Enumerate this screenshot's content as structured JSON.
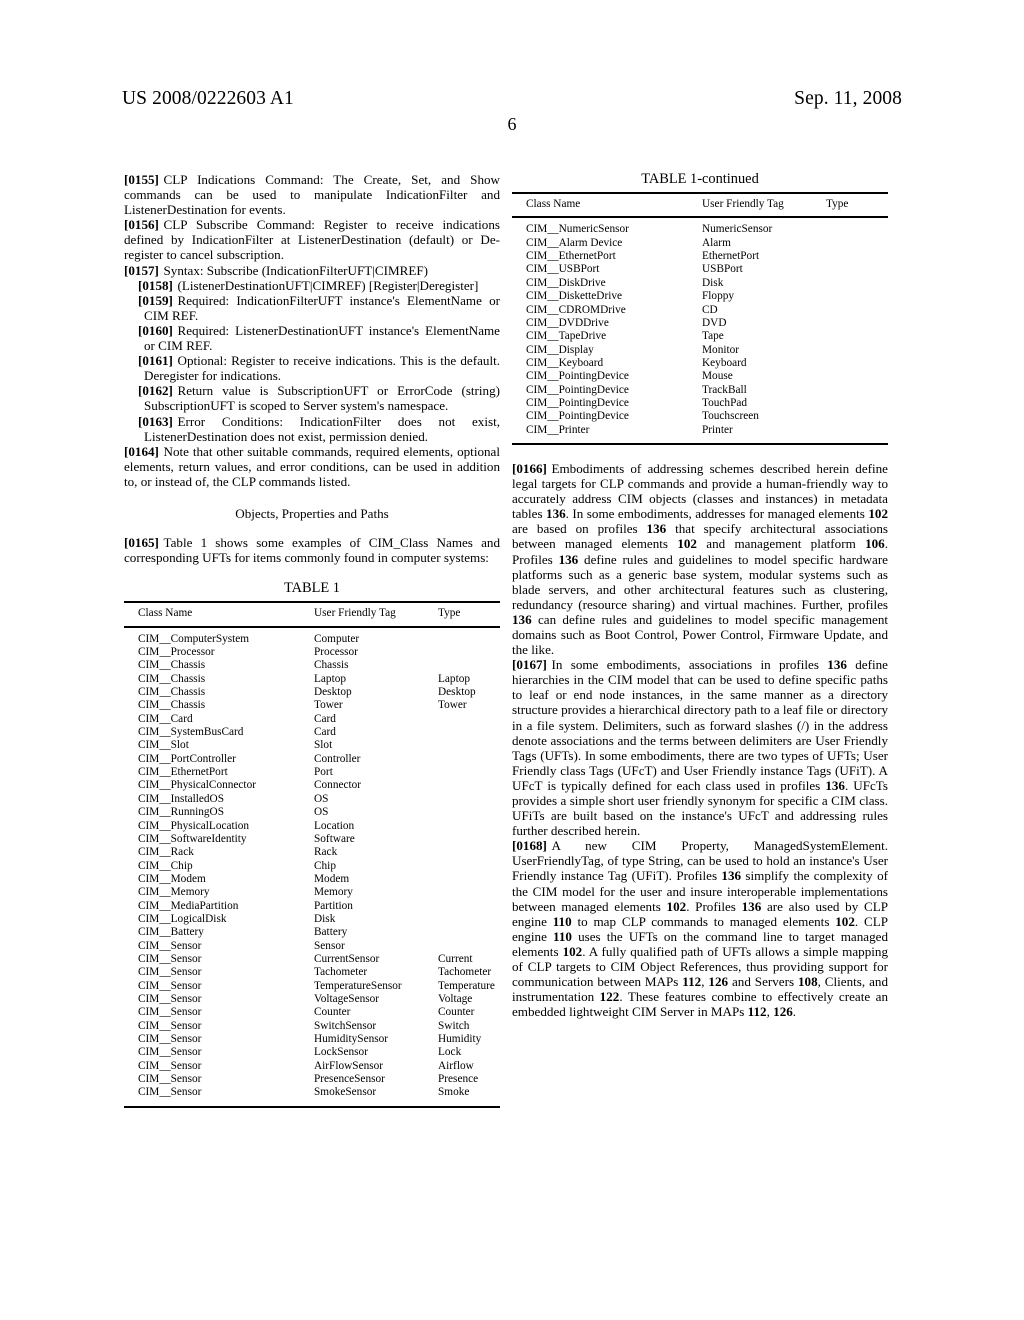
{
  "header": {
    "publication_number": "US 2008/0222603 A1",
    "publication_date": "Sep. 11, 2008",
    "page_number": "6"
  },
  "left_column": {
    "paragraphs": [
      {
        "id": "0155",
        "number": "[0155]",
        "text": "CLP Indications Command: The Create, Set, and Show commands can be used to manipulate IndicationFilter and ListenerDestination for events.",
        "style": "normal"
      },
      {
        "id": "0156",
        "number": "[0156]",
        "text": "CLP Subscribe Command: Register to receive indications defined by IndicationFilter at ListenerDestination (default) or De-register to cancel subscription.",
        "style": "normal"
      },
      {
        "id": "0157",
        "number": "[0157]",
        "text": "Syntax: Subscribe (IndicationFilterUFT|CIMREF)",
        "style": "normal"
      },
      {
        "id": "0158",
        "number": "[0158]",
        "text": "(ListenerDestinationUFT|CIMREF) [Register|Deregister]",
        "style": "sub"
      },
      {
        "id": "0159",
        "number": "[0159]",
        "text": "Required: IndicationFilterUFT instance's ElementName or CIM REF.",
        "style": "sub"
      },
      {
        "id": "0160",
        "number": "[0160]",
        "text": "Required: ListenerDestinationUFT instance's ElementName or CIM REF.",
        "style": "sub"
      },
      {
        "id": "0161",
        "number": "[0161]",
        "text": "Optional: Register to receive indications. This is the default. Deregister for indications.",
        "style": "sub"
      },
      {
        "id": "0162",
        "number": "[0162]",
        "text": "Return value is SubscriptionUFT or ErrorCode (string) SubscriptionUFT is scoped to Server system's namespace.",
        "style": "sub"
      },
      {
        "id": "0163",
        "number": "[0163]",
        "text": "Error Conditions: IndicationFilter does not exist, ListenerDestination does not exist, permission denied.",
        "style": "sub"
      },
      {
        "id": "0164",
        "number": "[0164]",
        "text": "Note that other suitable commands, required elements, optional elements, return values, and error conditions, can be used in addition to, or instead of, the CLP commands listed.",
        "style": "normal"
      }
    ],
    "section_heading": "Objects, Properties and Paths",
    "paragraph_0165": {
      "id": "0165",
      "number": "[0165]",
      "text": "Table 1 shows some examples of CIM_Class Names and corresponding UFTs for items commonly found in computer systems:"
    }
  },
  "table_1": {
    "title": "TABLE 1",
    "columns": [
      "Class Name",
      "User Friendly Tag",
      "Type"
    ],
    "rows": [
      [
        "CIM__ComputerSystem",
        "Computer",
        ""
      ],
      [
        "CIM__Processor",
        "Processor",
        ""
      ],
      [
        "CIM__Chassis",
        "Chassis",
        ""
      ],
      [
        "CIM__Chassis",
        "Laptop",
        "Laptop"
      ],
      [
        "CIM__Chassis",
        "Desktop",
        "Desktop"
      ],
      [
        "CIM__Chassis",
        "Tower",
        "Tower"
      ],
      [
        "CIM__Card",
        "Card",
        ""
      ],
      [
        "CIM__SystemBusCard",
        "Card",
        ""
      ],
      [
        "CIM__Slot",
        "Slot",
        ""
      ],
      [
        "CIM__PortController",
        "Controller",
        ""
      ],
      [
        "CIM__EthernetPort",
        "Port",
        ""
      ],
      [
        "CIM__PhysicalConnector",
        "Connector",
        ""
      ],
      [
        "CIM__InstalledOS",
        "OS",
        ""
      ],
      [
        "CIM__RunningOS",
        "OS",
        ""
      ],
      [
        "CIM__PhysicalLocation",
        "Location",
        ""
      ],
      [
        "CIM__SoftwareIdentity",
        "Software",
        ""
      ],
      [
        "CIM__Rack",
        "Rack",
        ""
      ],
      [
        "CIM__Chip",
        "Chip",
        ""
      ],
      [
        "CIM__Modem",
        "Modem",
        ""
      ],
      [
        "CIM__Memory",
        "Memory",
        ""
      ],
      [
        "CIM__MediaPartition",
        "Partition",
        ""
      ],
      [
        "CIM__LogicalDisk",
        "Disk",
        ""
      ],
      [
        "CIM__Battery",
        "Battery",
        ""
      ],
      [
        "CIM__Sensor",
        "Sensor",
        ""
      ],
      [
        "CIM__Sensor",
        "CurrentSensor",
        "Current"
      ],
      [
        "CIM__Sensor",
        "Tachometer",
        "Tachometer"
      ],
      [
        "CIM__Sensor",
        "TemperatureSensor",
        "Temperature"
      ],
      [
        "CIM__Sensor",
        "VoltageSensor",
        "Voltage"
      ],
      [
        "CIM__Sensor",
        "Counter",
        "Counter"
      ],
      [
        "CIM__Sensor",
        "SwitchSensor",
        "Switch"
      ],
      [
        "CIM__Sensor",
        "HumiditySensor",
        "Humidity"
      ],
      [
        "CIM__Sensor",
        "LockSensor",
        "Lock"
      ],
      [
        "CIM__Sensor",
        "AirFlowSensor",
        "Airflow"
      ],
      [
        "CIM__Sensor",
        "PresenceSensor",
        "Presence"
      ],
      [
        "CIM__Sensor",
        "SmokeSensor",
        "Smoke"
      ]
    ]
  },
  "table_1_continued": {
    "title": "TABLE 1-continued",
    "columns": [
      "Class Name",
      "User Friendly Tag",
      "Type"
    ],
    "rows": [
      [
        "CIM__NumericSensor",
        "NumericSensor",
        ""
      ],
      [
        "CIM__Alarm Device",
        "Alarm",
        ""
      ],
      [
        "CIM__EthernetPort",
        "EthernetPort",
        ""
      ],
      [
        "CIM__USBPort",
        "USBPort",
        ""
      ],
      [
        "CIM__DiskDrive",
        "Disk",
        ""
      ],
      [
        "CIM__DisketteDrive",
        "Floppy",
        ""
      ],
      [
        "CIM__CDROMDrive",
        "CD",
        ""
      ],
      [
        "CIM__DVDDrive",
        "DVD",
        ""
      ],
      [
        "CIM__TapeDrive",
        "Tape",
        ""
      ],
      [
        "CIM__Display",
        "Monitor",
        ""
      ],
      [
        "CIM__Keyboard",
        "Keyboard",
        ""
      ],
      [
        "CIM__PointingDevice",
        "Mouse",
        ""
      ],
      [
        "CIM__PointingDevice",
        "TrackBall",
        ""
      ],
      [
        "CIM__PointingDevice",
        "TouchPad",
        ""
      ],
      [
        "CIM__PointingDevice",
        "Touchscreen",
        ""
      ],
      [
        "CIM__Printer",
        "Printer",
        ""
      ]
    ]
  },
  "right_column": {
    "paragraph_0166": {
      "number": "[0166]",
      "segments": [
        {
          "t": "Embodiments of addressing schemes described herein define legal targets for CLP commands and provide a human-friendly way to accurately address CIM objects (classes and instances) in metadata tables ",
          "b": false
        },
        {
          "t": "136",
          "b": true
        },
        {
          "t": ". In some embodiments, addresses for managed elements ",
          "b": false
        },
        {
          "t": "102",
          "b": true
        },
        {
          "t": " are based on profiles ",
          "b": false
        },
        {
          "t": "136",
          "b": true
        },
        {
          "t": " that specify architectural associations between managed elements ",
          "b": false
        },
        {
          "t": "102",
          "b": true
        },
        {
          "t": " and management platform ",
          "b": false
        },
        {
          "t": "106",
          "b": true
        },
        {
          "t": ". Profiles ",
          "b": false
        },
        {
          "t": "136",
          "b": true
        },
        {
          "t": " define rules and guidelines to model specific hardware platforms such as a generic base system, modular systems such as blade servers, and other architectural features such as clustering, redundancy (resource sharing) and virtual machines. Further, profiles ",
          "b": false
        },
        {
          "t": "136",
          "b": true
        },
        {
          "t": " can define rules and guidelines to model specific management domains such as Boot Control, Power Control, Firmware Update, and the like.",
          "b": false
        }
      ]
    },
    "paragraph_0167": {
      "number": "[0167]",
      "segments": [
        {
          "t": "In some embodiments, associations in profiles ",
          "b": false
        },
        {
          "t": "136",
          "b": true
        },
        {
          "t": " define hierarchies in the CIM model that can be used to define specific paths to leaf or end node instances, in the same manner as a directory structure provides a hierarchical directory path to a leaf file or directory in a file system. Delimiters, such as forward slashes (/) in the address denote associations and the terms between delimiters are User Friendly Tags (UFTs). In some embodiments, there are two types of UFTs; User Friendly class Tags (UFcT) and User Friendly instance Tags (UFiT). A UFcT is typically defined for each class used in profiles ",
          "b": false
        },
        {
          "t": "136",
          "b": true
        },
        {
          "t": ". UFcTs provides a simple short user friendly synonym for specific a CIM class. UFiTs are built based on the instance's UFcT and addressing rules further described herein.",
          "b": false
        }
      ]
    },
    "paragraph_0168": {
      "number": "[0168]",
      "segments": [
        {
          "t": "A new CIM Property, ManagedSystemElement. UserFriendlyTag, of type String, can be used to hold an instance's User Friendly instance Tag (UFiT). Profiles ",
          "b": false
        },
        {
          "t": "136",
          "b": true
        },
        {
          "t": " simplify the complexity of the CIM model for the user and insure interoperable implementations between managed elements ",
          "b": false
        },
        {
          "t": "102",
          "b": true
        },
        {
          "t": ". Profiles ",
          "b": false
        },
        {
          "t": "136",
          "b": true
        },
        {
          "t": " are also used by CLP engine ",
          "b": false
        },
        {
          "t": "110",
          "b": true
        },
        {
          "t": " to map CLP commands to managed elements ",
          "b": false
        },
        {
          "t": "102",
          "b": true
        },
        {
          "t": ". CLP engine ",
          "b": false
        },
        {
          "t": "110",
          "b": true
        },
        {
          "t": " uses the UFTs on the command line to target managed elements ",
          "b": false
        },
        {
          "t": "102",
          "b": true
        },
        {
          "t": ". A fully qualified path of UFTs allows a simple mapping of CLP targets to CIM Object References, thus providing support for communication between MAPs ",
          "b": false
        },
        {
          "t": "112",
          "b": true
        },
        {
          "t": ", ",
          "b": false
        },
        {
          "t": "126",
          "b": true
        },
        {
          "t": " and Servers ",
          "b": false
        },
        {
          "t": "108",
          "b": true
        },
        {
          "t": ", Clients, and instrumentation ",
          "b": false
        },
        {
          "t": "122",
          "b": true
        },
        {
          "t": ". These features combine to effectively create an embedded lightweight CIM Server in MAPs ",
          "b": false
        },
        {
          "t": "112",
          "b": true
        },
        {
          "t": ", ",
          "b": false
        },
        {
          "t": "126",
          "b": true
        },
        {
          "t": ".",
          "b": false
        }
      ]
    }
  }
}
